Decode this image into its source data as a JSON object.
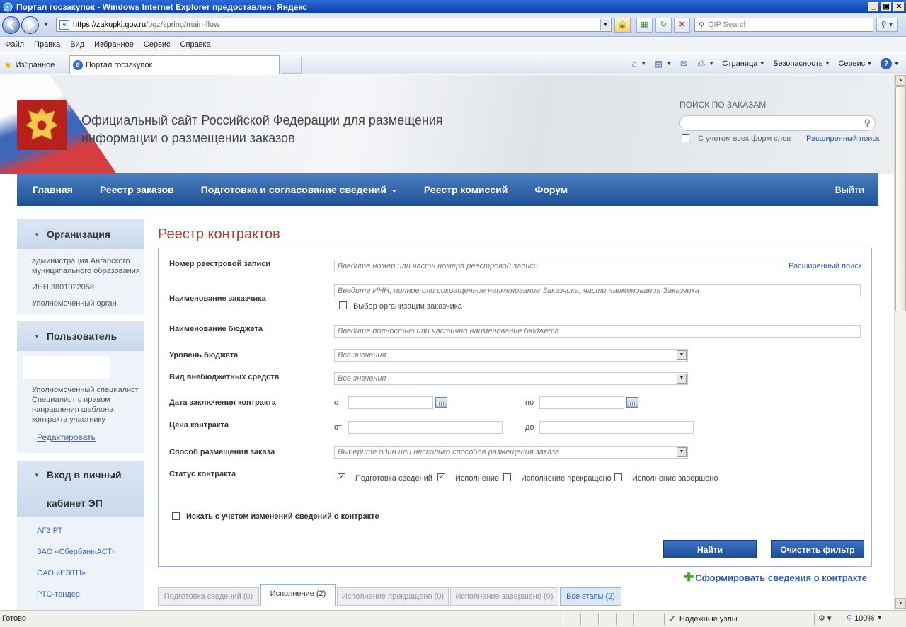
{
  "window": {
    "title": "Портал госзакупок - Windows Internet Explorer предоставлен: Яндекс",
    "buttons": [
      "_",
      "▣",
      "✕"
    ]
  },
  "address": {
    "url_domain": "https://zakupki.gov.ru",
    "url_path": "/pgz/spring/main-flow",
    "search_placeholder": "QIP Search"
  },
  "menu": [
    "Файл",
    "Правка",
    "Вид",
    "Избранное",
    "Сервис",
    "Справка"
  ],
  "favorites": {
    "label": "Избранное",
    "tab_title": "Портал госзакупок"
  },
  "command_bar": {
    "page": "Страница",
    "safety": "Безопасность",
    "tools": "Сервис"
  },
  "header": {
    "site_title": "Официальный сайт Российской Федерации для размещения информации о размещении заказов",
    "search_label": "ПОИСК ПО ЗАКАЗАМ",
    "wordforms_label": "С учетом всех форм слов",
    "advanced_search": "Расширенный поиск"
  },
  "nav": {
    "items": [
      "Главная",
      "Реестр заказов",
      "Подготовка и согласование сведений",
      "Реестр комиссий",
      "Форум"
    ],
    "logout": "Выйти"
  },
  "sidebar": {
    "org": {
      "title": "Организация",
      "name": "администрация Ангарского муниципального образования",
      "inn": "ИНН 3801022058",
      "role": "Уполномоченный орган"
    },
    "user": {
      "title": "Пользователь",
      "roles": "Уполномоченный специалист Специалист с правом направления шаблона контракта участнику",
      "edit": "Редактировать"
    },
    "ep": {
      "title_line1": "Вход в личный",
      "title_line2": "кабинет ЭП",
      "links": [
        "АГЗ РТ",
        "ЗАО «Сбербанк-АСТ»",
        "ОАО «ЕЭТП»",
        "РТС-тендер"
      ]
    }
  },
  "form": {
    "heading": "Реестр контрактов",
    "registry_label": "Номер реестровой записи",
    "registry_placeholder": "Введите номер или часть номера реестровой записи",
    "advanced": "Расширенный поиск",
    "customer_label": "Наименование заказчика",
    "customer_placeholder": "Введите ИНН, полное или сокращенное наименование Заказчика, части наименования Заказчика",
    "customer_choose": "Выбор организации заказчика",
    "budget_label": "Наименование бюджета",
    "budget_placeholder": "Введите полностью или частично наименование бюджета",
    "budget_level_label": "Уровень бюджета",
    "budget_level_value": "Все значения",
    "offbudget_label": "Вид внебюджетных средств",
    "offbudget_value": "Все значения",
    "date_label": "Дата заключения контракта",
    "date_from": "с",
    "date_to": "по",
    "price_label": "Цена контракта",
    "price_from": "от",
    "price_to": "до",
    "method_label": "Способ размещения заказа",
    "method_placeholder": "Выберите один или несколько способов размещения заказа",
    "status_label": "Статус контракта",
    "statuses": [
      {
        "label": "Подготовка сведений",
        "checked": true
      },
      {
        "label": "Исполнение",
        "checked": true
      },
      {
        "label": "Исполнение прекращено",
        "checked": false
      },
      {
        "label": "Исполнение завершено",
        "checked": false
      }
    ],
    "changes_label": "Искать с учетом изменений сведений о контракте",
    "find_button": "Найти",
    "clear_button": "Очистить фильтр",
    "form_contract": "Сформировать сведения о контракте"
  },
  "tabs": [
    {
      "label": "Подготовка сведений (0)"
    },
    {
      "label": "Исполнение (2)"
    },
    {
      "label": "Исполнение прекращено (0)"
    },
    {
      "label": "Исполнение завершено (0)"
    },
    {
      "label": "Все этапы (2)"
    }
  ],
  "status": {
    "text": "Готово",
    "zone": "Надежные узлы",
    "zoom": "100%"
  }
}
